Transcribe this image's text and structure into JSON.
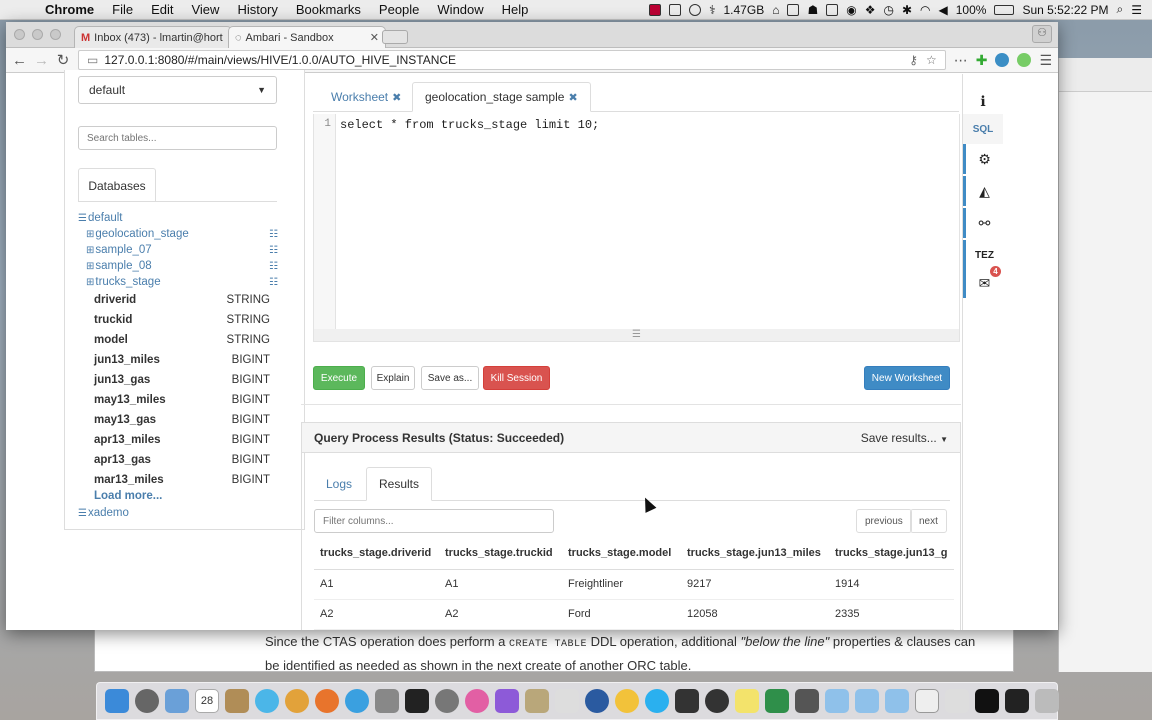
{
  "menubar": {
    "apple": "",
    "app": "Chrome",
    "items": [
      "File",
      "Edit",
      "View",
      "History",
      "Bookmarks",
      "People",
      "Window",
      "Help"
    ],
    "cpu": "1.47GB",
    "battery": "100%",
    "clock": "Sun 5:52:22 PM"
  },
  "browser": {
    "tabs": [
      {
        "label": "Inbox (473) - lmartin@hort"
      },
      {
        "label": "Ambari - Sandbox"
      }
    ],
    "url": "127.0.0.1:8080/#/main/views/HIVE/1.0.0/AUTO_HIVE_INSTANCE"
  },
  "left": {
    "database_select": "default",
    "search_placeholder": "Search tables...",
    "tab_label": "Databases",
    "db_default": "default",
    "tables": [
      "geolocation_stage",
      "sample_07",
      "sample_08",
      "trucks_stage"
    ],
    "columns": [
      {
        "name": "driverid",
        "type": "STRING"
      },
      {
        "name": "truckid",
        "type": "STRING"
      },
      {
        "name": "model",
        "type": "STRING"
      },
      {
        "name": "jun13_miles",
        "type": "BIGINT"
      },
      {
        "name": "jun13_gas",
        "type": "BIGINT"
      },
      {
        "name": "may13_miles",
        "type": "BIGINT"
      },
      {
        "name": "may13_gas",
        "type": "BIGINT"
      },
      {
        "name": "apr13_miles",
        "type": "BIGINT"
      },
      {
        "name": "apr13_gas",
        "type": "BIGINT"
      },
      {
        "name": "mar13_miles",
        "type": "BIGINT"
      }
    ],
    "load_more": "Load more...",
    "db_other": "xademo"
  },
  "editor": {
    "tabs": [
      "Worksheet",
      "geolocation_stage sample"
    ],
    "line_no": "1",
    "query": "select * from trucks_stage limit 10;",
    "buttons": {
      "execute": "Execute",
      "explain": "Explain",
      "save_as": "Save as...",
      "kill": "Kill Session",
      "new_ws": "New Worksheet"
    }
  },
  "side": {
    "sql": "SQL",
    "tez": "TEZ",
    "badge": "4"
  },
  "results": {
    "title": "Query Process Results (Status: Succeeded)",
    "save": "Save results...",
    "tabs": [
      "Logs",
      "Results"
    ],
    "filter_placeholder": "Filter columns...",
    "previous": "previous",
    "next": "next",
    "headers": [
      "trucks_stage.driverid",
      "trucks_stage.truckid",
      "trucks_stage.model",
      "trucks_stage.jun13_miles",
      "trucks_stage.jun13_g"
    ],
    "rows": [
      [
        "A1",
        "A1",
        "Freightliner",
        "9217",
        "1914"
      ],
      [
        "A2",
        "A2",
        "Ford",
        "12058",
        "2335"
      ]
    ]
  },
  "doc": {
    "line1_a": "Since the CTAS operation does perform a",
    "line1_code": "CREATE TABLE",
    "line1_b": "DDL operation, additional",
    "line1_em": "\"below the line\"",
    "line1_c": "properties & clauses can",
    "line2": "be identified as needed as shown in the next create of another ORC table."
  },
  "dock": {
    "calendar_day": "28"
  }
}
